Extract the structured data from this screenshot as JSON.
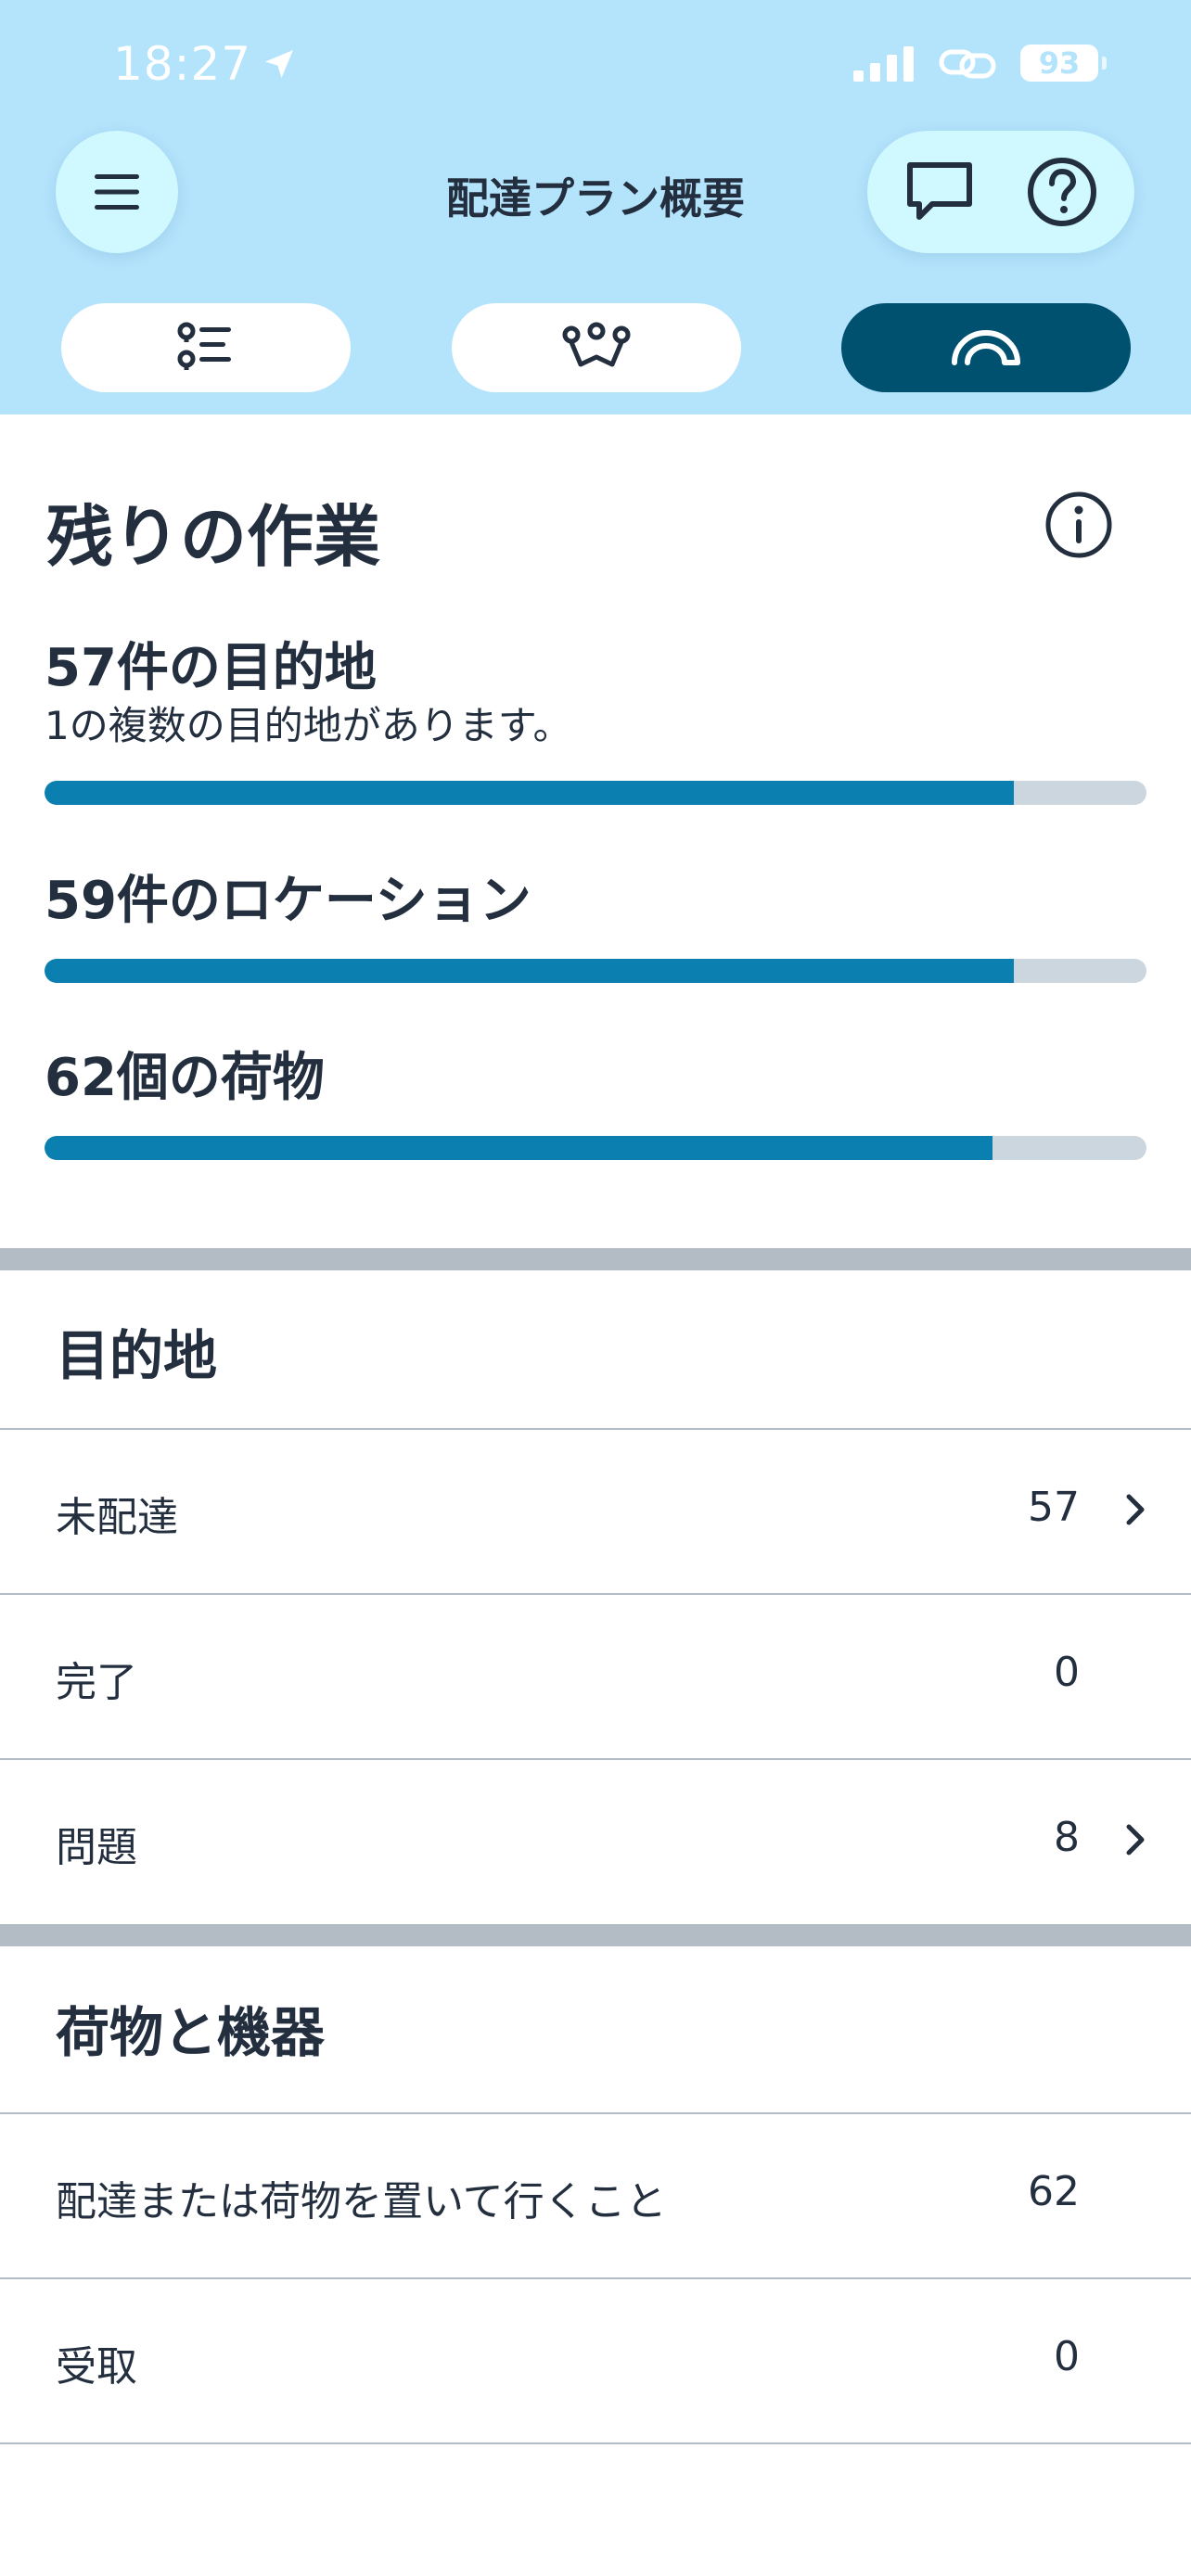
{
  "status_bar": {
    "time": "18:27",
    "battery": "93"
  },
  "header": {
    "title": "配達プラン概要"
  },
  "segments": [
    {
      "icon": "checklist-icon",
      "active": false
    },
    {
      "icon": "route-map-icon",
      "active": false
    },
    {
      "icon": "gauge-icon",
      "active": true
    }
  ],
  "remaining": {
    "title": "残りの作業",
    "destinations": {
      "title": "57件の目的地",
      "subtitle": "1の複数の目的地があります。",
      "progress": 0.88
    },
    "locations": {
      "title": "59件のロケーション",
      "progress": 0.88
    },
    "packages": {
      "title": "62個の荷物",
      "progress": 0.86
    }
  },
  "destinations_group": {
    "title": "目的地",
    "rows": [
      {
        "label": "未配達",
        "value": "57",
        "chevron": true
      },
      {
        "label": "完了",
        "value": "0",
        "chevron": false
      },
      {
        "label": "問題",
        "value": "8",
        "chevron": true
      }
    ]
  },
  "packages_group": {
    "title": "荷物と機器",
    "rows": [
      {
        "label": "配達または荷物を置いて行くこと",
        "value": "62",
        "chevron": false
      },
      {
        "label": "受取",
        "value": "0",
        "chevron": false
      }
    ]
  },
  "colors": {
    "header_bg": "#b4e3fc",
    "active_segment": "#00506f",
    "progress_fill": "#0b7fb0",
    "progress_track": "#ccd6df"
  }
}
